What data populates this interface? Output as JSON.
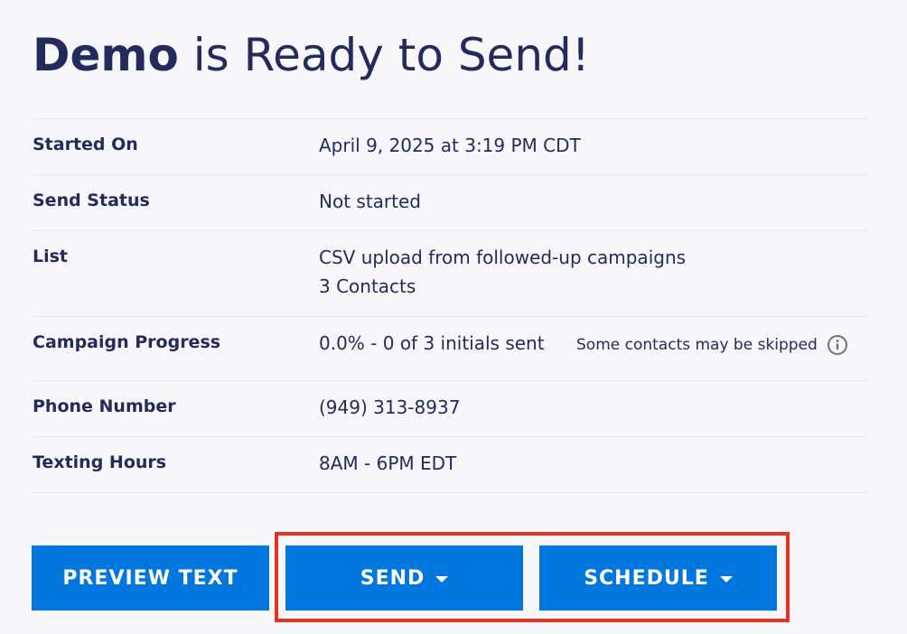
{
  "header": {
    "name": "Demo",
    "title_suffix": "is Ready to Send!"
  },
  "details": [
    {
      "label": "Started On",
      "value": "April 9, 2025 at 3:19 PM CDT"
    },
    {
      "label": "Send Status",
      "value": "Not started"
    },
    {
      "label": "List",
      "value_line1": "CSV upload from followed-up campaigns",
      "value_line2": "3 Contacts"
    },
    {
      "label": "Campaign Progress",
      "value": "0.0% - 0 of 3 initials sent",
      "note": "Some contacts may be skipped",
      "note_icon": "info-icon"
    },
    {
      "label": "Phone Number",
      "value": "(949) 313-8937"
    },
    {
      "label": "Texting Hours",
      "value": "8AM - 6PM EDT"
    }
  ],
  "actions": {
    "preview_label": "PREVIEW TEXT",
    "send_label": "SEND",
    "schedule_label": "SCHEDULE",
    "dropdown_icon": "caret-down-icon"
  },
  "colors": {
    "primary": "#0077de",
    "text": "#232a5c",
    "background": "#f7f7fb",
    "highlight": "#e8321e"
  }
}
